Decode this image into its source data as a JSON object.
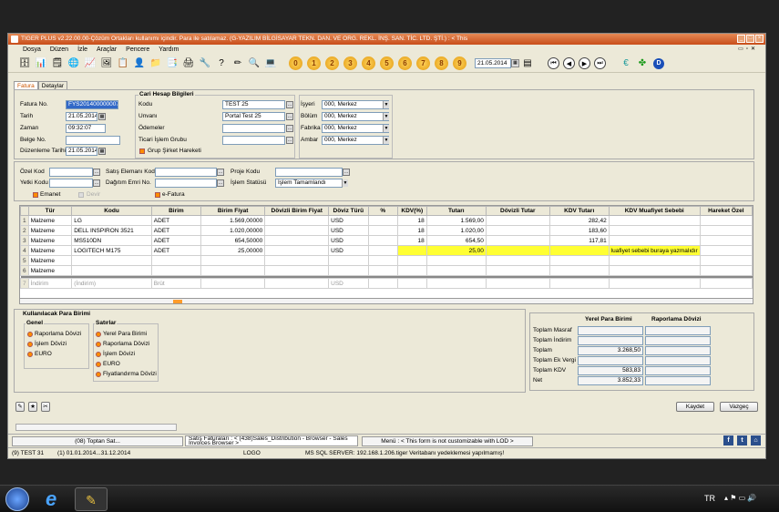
{
  "window": {
    "title": "TIGER PLUS v2.22.00.00-Çözüm Ortakları kullanımı içindir. Para ile satılamaz. (G-YAZILIM BİLGİSAYAR TEKN. DAN. VE ORG. REKL. İNŞ. SAN. TİC. LTD. ŞTİ.) : < This"
  },
  "menu": [
    "Dosya",
    "Düzen",
    "İzle",
    "Araçlar",
    "Pencere",
    "Yardım"
  ],
  "toolbar": {
    "numbers": [
      "0",
      "1",
      "2",
      "3",
      "4",
      "5",
      "6",
      "7",
      "8",
      "9"
    ],
    "date": "21.05.2014"
  },
  "tabs": [
    "Fatura",
    "Detaylar"
  ],
  "header": {
    "fatura_no_label": "Fatura No.",
    "fatura_no": "FYS2014000000079",
    "tarih_label": "Tarih",
    "tarih": "21.05.2014",
    "zaman_label": "Zaman",
    "zaman": "09:32:07",
    "belge_label": "Belge No.",
    "duz_label": "Düzenleme Tarihi",
    "duz": "21.05.2014"
  },
  "cari": {
    "title": "Cari Hesap Bilgileri",
    "kodu_label": "Kodu",
    "kodu": "TEST 25",
    "unvan_label": "Unvanı",
    "unvan": "Portal Test 25",
    "odemeler_label": "Ödemeler",
    "ticari_label": "Ticari İşlem Grubu",
    "grup_label": "Grup Şirket Hareketi"
  },
  "org": {
    "isyeri_label": "İşyeri",
    "isyeri": "000, Merkez",
    "bolum_label": "Bölüm",
    "bolum": "000, Merkez",
    "fabrika_label": "Fabrika",
    "fabrika": "000, Merkez",
    "ambar_label": "Ambar",
    "ambar": "000, Merkez"
  },
  "misc": {
    "ozel": "Özel Kod",
    "yetki": "Yetki Kodu",
    "satis": "Satış Elemanı Kodu",
    "dagitim": "Dağıtım Emri No.",
    "proje": "Proje Kodu",
    "islem_durumu": "İşlem Statüsü",
    "islem_value": "İşlem Tamamlandı",
    "emanet": "Emanet",
    "devir": "Devir",
    "efatura": "e-Fatura"
  },
  "grid": {
    "columns": [
      "Tür",
      "Kodu",
      "Birim",
      "Birim Fiyat",
      "Dövizli Birim Fiyat",
      "Döviz Türü",
      "%",
      "KDV(%)",
      "Tutarı",
      "Dövizli Tutar",
      "KDV Tutarı",
      "KDV Muafiyet Sebebi",
      "Hareket Özel"
    ],
    "rows": [
      {
        "no": "1",
        "tur": "Malzeme",
        "kodu": "LG",
        "birim": "ADET",
        "fiyat": "1.569,00000",
        "doviz": "USD",
        "kdv": "18",
        "tutar": "1.569,00",
        "kdvt": "282,42",
        "muaf": ""
      },
      {
        "no": "2",
        "tur": "Malzeme",
        "kodu": "DELL INSPIRON 3521",
        "birim": "ADET",
        "fiyat": "1.020,00000",
        "doviz": "USD",
        "kdv": "18",
        "tutar": "1.020,00",
        "kdvt": "183,60",
        "muaf": ""
      },
      {
        "no": "3",
        "tur": "Malzeme",
        "kodu": "MS510DN",
        "birim": "ADET",
        "fiyat": "654,50000",
        "doviz": "USD",
        "kdv": "18",
        "tutar": "654,50",
        "kdvt": "117,81",
        "muaf": ""
      },
      {
        "no": "4",
        "tur": "Malzeme",
        "kodu": "LOGITECH M175",
        "birim": "ADET",
        "fiyat": "25,00000",
        "doviz": "USD",
        "kdv": "",
        "tutar": "25,00",
        "kdvt": "",
        "muaf": "luafiyet sebebi buraya yazmalıdır"
      },
      {
        "no": "5",
        "tur": "Malzeme",
        "kodu": "",
        "birim": "",
        "fiyat": "",
        "doviz": "",
        "kdv": "",
        "tutar": "",
        "kdvt": "",
        "muaf": ""
      },
      {
        "no": "6",
        "tur": "Malzeme",
        "kodu": "",
        "birim": "",
        "fiyat": "",
        "doviz": "",
        "kdv": "",
        "tutar": "",
        "kdvt": "",
        "muaf": ""
      },
      {
        "no": "7",
        "tur": "İndirim",
        "kodu": "(İndirim)",
        "birim": "Brüt",
        "fiyat": "",
        "doviz": "USD",
        "kdv": "",
        "tutar": "",
        "kdvt": "",
        "muaf": ""
      }
    ]
  },
  "currency": {
    "title": "Kullanılacak Para Birimi",
    "genel": "Genel",
    "genel_opts": [
      "Raporlama Dövizi",
      "İşlem Dövizi",
      "EURO"
    ],
    "satirlar": "Satırlar",
    "satir_opts": [
      "Yerel Para Birimi",
      "Raporlama Dövizi",
      "İşlem Dövizi",
      "EURO",
      "Fiyatlandırma Dövizi"
    ]
  },
  "totals": {
    "col1": "Yerel Para Birimi",
    "col2": "Raporlama Dövizi",
    "rows": [
      {
        "label": "Toplam Masraf",
        "v": ""
      },
      {
        "label": "Toplam İndirim",
        "v": ""
      },
      {
        "label": "Toplam",
        "v": "3.268,50"
      },
      {
        "label": "Toplam Ek Vergi",
        "v": ""
      },
      {
        "label": "Toplam KDV",
        "v": "583,83"
      },
      {
        "label": "Net",
        "v": "3.852,33"
      }
    ]
  },
  "buttons": {
    "save": "Kaydet",
    "cancel": "Vazgeç"
  },
  "status": {
    "b1": "(08) Toptan Sat...",
    "b2": "Satış Faturaları : < (438)Sales_Distribution - Browser - Sales Invoices Browser >",
    "b3": "Menü : < This form is not customizable with LOD >",
    "s1": "(9) TEST 31",
    "s2": "(1) 01.01.2014...31.12.2014",
    "s3": "LOGO",
    "s4": "MS SQL SERVER: 192.168.1.206.tiger Veritabanı yedeklemesi yapılmamış!"
  },
  "taskbar": {
    "lang": "TR"
  }
}
